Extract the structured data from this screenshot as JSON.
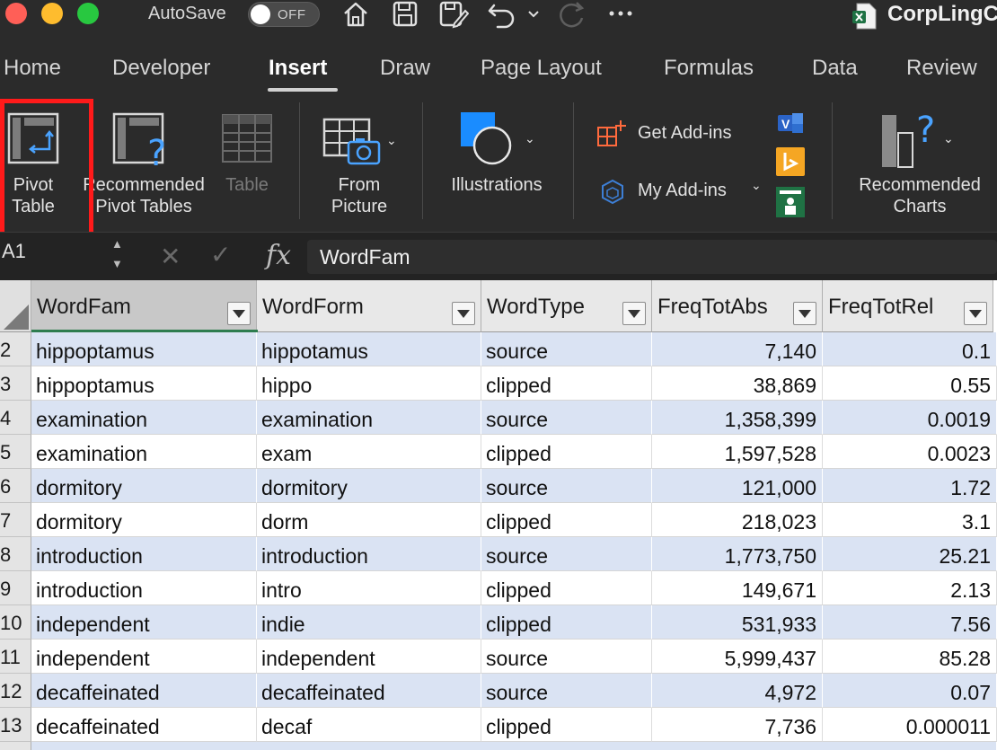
{
  "titlebar": {
    "autosave_label": "AutoSave",
    "autosave_state": "OFF",
    "doc_title": "CorpLingC"
  },
  "tabs": [
    {
      "label": "Home",
      "active": false
    },
    {
      "label": "Developer",
      "active": false
    },
    {
      "label": "Insert",
      "active": true
    },
    {
      "label": "Draw",
      "active": false
    },
    {
      "label": "Page Layout",
      "active": false
    },
    {
      "label": "Formulas",
      "active": false
    },
    {
      "label": "Data",
      "active": false
    },
    {
      "label": "Review",
      "active": false
    }
  ],
  "ribbon": {
    "pivot_table": [
      "Pivot",
      "Table"
    ],
    "recommended_pivot": [
      "Recommended",
      "Pivot Tables"
    ],
    "table": "Table",
    "from_picture": [
      "From",
      "Picture"
    ],
    "illustrations": "Illustrations",
    "get_addins": "Get Add-ins",
    "my_addins": "My Add-ins",
    "recommended_charts": [
      "Recommended",
      "Charts"
    ]
  },
  "formula_bar": {
    "name_box": "A1",
    "formula": "WordFam"
  },
  "colors": {
    "accent_highlight": "#ff1a1a",
    "band": "#dae3f3",
    "selection": "#2e7d4f"
  },
  "sheet": {
    "columns": [
      "WordFam",
      "WordForm",
      "WordType",
      "FreqTotAbs",
      "FreqTotRel"
    ],
    "rows": [
      {
        "n": "2",
        "c": [
          "hippoptamus",
          "hippotamus",
          "source",
          "7,140",
          "0.1"
        ]
      },
      {
        "n": "3",
        "c": [
          "hippoptamus",
          "hippo",
          "clipped",
          "38,869",
          "0.55"
        ]
      },
      {
        "n": "4",
        "c": [
          "examination",
          "examination",
          "source",
          "1,358,399",
          "0.0019"
        ]
      },
      {
        "n": "5",
        "c": [
          "examination",
          "exam",
          "clipped",
          "1,597,528",
          "0.0023"
        ]
      },
      {
        "n": "6",
        "c": [
          "dormitory",
          "dormitory",
          "source",
          "121,000",
          "1.72"
        ]
      },
      {
        "n": "7",
        "c": [
          "dormitory",
          "dorm",
          "clipped",
          "218,023",
          "3.1"
        ]
      },
      {
        "n": "8",
        "c": [
          "introduction",
          "introduction",
          "source",
          "1,773,750",
          "25.21"
        ]
      },
      {
        "n": "9",
        "c": [
          "introduction",
          "intro",
          "clipped",
          "149,671",
          "2.13"
        ]
      },
      {
        "n": "10",
        "c": [
          "independent",
          "indie",
          "clipped",
          "531,933",
          "7.56"
        ]
      },
      {
        "n": "11",
        "c": [
          "independent",
          "independent",
          "source",
          "5,999,437",
          "85.28"
        ]
      },
      {
        "n": "12",
        "c": [
          "decaffeinated",
          "decaffeinated",
          "source",
          "4,972",
          "0.07"
        ]
      },
      {
        "n": "13",
        "c": [
          "decaffeinated",
          "decaf",
          "clipped",
          "7,736",
          "0.000011"
        ]
      }
    ]
  }
}
